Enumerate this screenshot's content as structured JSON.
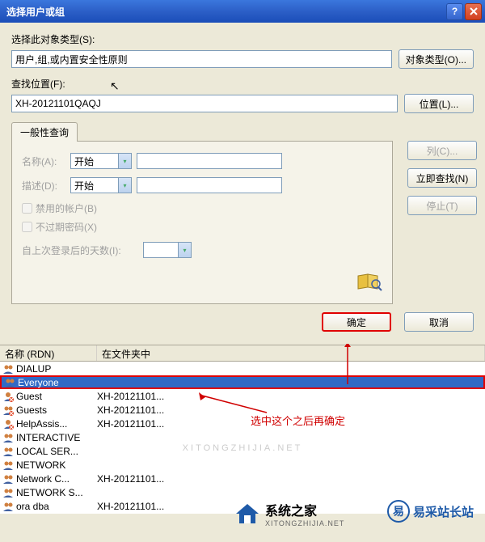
{
  "titlebar": {
    "title": "选择用户或组"
  },
  "objtype": {
    "label": "选择此对象类型(S):",
    "value": "用户,组,或内置安全性原则",
    "button": "对象类型(O)..."
  },
  "location": {
    "label": "查找位置(F):",
    "value": "XH-20121101QAQJ",
    "button": "位置(L)..."
  },
  "tab": {
    "label": "一般性查询"
  },
  "query": {
    "name_label": "名称(A):",
    "desc_label": "描述(D):",
    "combo_value": "开始",
    "chk_disabled": "禁用的帐户(B)",
    "chk_noexpire": "不过期密码(X)",
    "lastlogin_label": "自上次登录后的天数(I):"
  },
  "side_buttons": {
    "columns": "列(C)...",
    "findnow": "立即查找(N)",
    "stop": "停止(T)"
  },
  "bottom": {
    "ok": "确定",
    "cancel": "取消"
  },
  "results": {
    "col1": "名称 (RDN)",
    "col2": "在文件夹中",
    "rows": [
      {
        "name": "DIALUP",
        "folder": "",
        "icon": "group"
      },
      {
        "name": "Everyone",
        "folder": "",
        "icon": "group",
        "selected": true
      },
      {
        "name": "Guest",
        "folder": "XH-20121101...",
        "icon": "user-x"
      },
      {
        "name": "Guests",
        "folder": "XH-20121101...",
        "icon": "group-x"
      },
      {
        "name": "HelpAssis...",
        "folder": "XH-20121101...",
        "icon": "user-x"
      },
      {
        "name": "INTERACTIVE",
        "folder": "",
        "icon": "group"
      },
      {
        "name": "LOCAL SER...",
        "folder": "",
        "icon": "group"
      },
      {
        "name": "NETWORK",
        "folder": "",
        "icon": "group"
      },
      {
        "name": "Network C...",
        "folder": "XH-20121101...",
        "icon": "group"
      },
      {
        "name": "NETWORK S...",
        "folder": "",
        "icon": "group"
      },
      {
        "name": "ora dba",
        "folder": "XH-20121101...",
        "icon": "group"
      }
    ]
  },
  "annotation": {
    "text": "选中这个之后再确定"
  },
  "watermark": "XITONGZHIJIA.NET",
  "logos": {
    "left_name": "系统之家",
    "left_url": "XITONGZHIJIA.NET",
    "right_char": "易",
    "right_name": "易采站长站"
  }
}
